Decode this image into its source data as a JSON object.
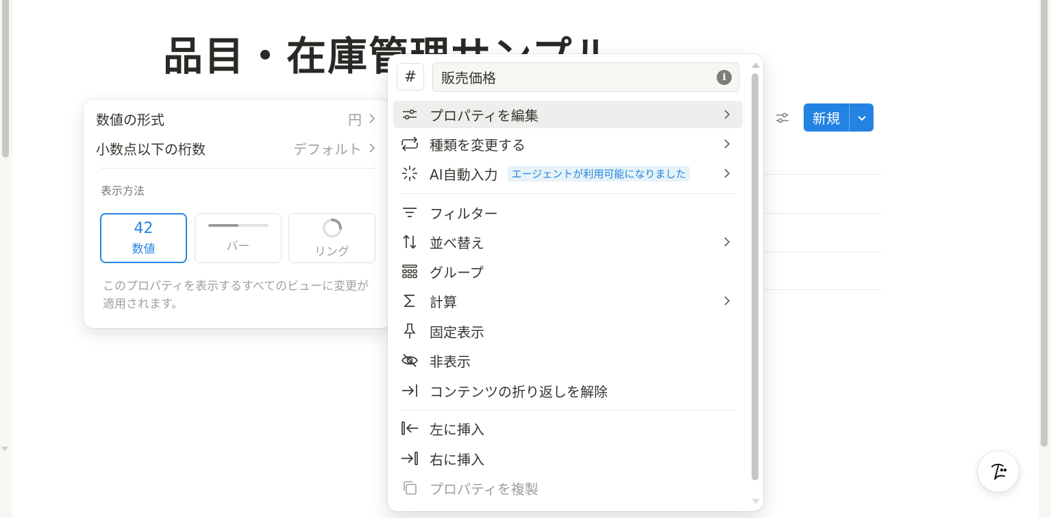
{
  "page": {
    "title": "品目・在庫管理サンプル"
  },
  "toolbar": {
    "settings_icon": "sliders-icon",
    "new_label": "新規",
    "new_dropdown_icon": "chevron-down-icon"
  },
  "format_panel": {
    "rows": [
      {
        "label": "数値の形式",
        "value": "円"
      },
      {
        "label": "小数点以下の桁数",
        "value": "デフォルト"
      }
    ],
    "section_label": "表示方法",
    "display_options": [
      {
        "big": "42",
        "label": "数値",
        "selected": true
      },
      {
        "label": "バー",
        "selected": false,
        "bar_fill_fraction": 0.5
      },
      {
        "label": "リング",
        "selected": false,
        "ring_fill_fraction": 0.25
      }
    ],
    "note": "このプロパティを表示するすべてのビューに変更が適用されます。"
  },
  "property_menu": {
    "type_icon": "#",
    "name_value": "販売価格",
    "info_icon_glyph": "i",
    "items": [
      {
        "label": "プロパティを編集",
        "icon": "sliders-icon",
        "chevron": true,
        "hover": true
      },
      {
        "label": "種類を変更する",
        "icon": "swap-icon",
        "chevron": true
      },
      {
        "label": "AI自動入力",
        "icon": "sparkle-icon",
        "badge": "エージェントが利用可能になりました",
        "chevron": true
      },
      {
        "label": "フィルター",
        "icon": "filter-icon",
        "chevron": false
      },
      {
        "label": "並べ替え",
        "icon": "sort-icon",
        "chevron": true
      },
      {
        "label": "グループ",
        "icon": "group-icon",
        "chevron": false
      },
      {
        "label": "計算",
        "icon": "sigma-icon",
        "chevron": true
      },
      {
        "label": "固定表示",
        "icon": "pin-icon",
        "chevron": false
      },
      {
        "label": "非表示",
        "icon": "eye-off-icon",
        "chevron": false
      },
      {
        "label": "コンテンツの折り返しを解除",
        "icon": "unwrap-icon",
        "chevron": false
      },
      {
        "label": "左に挿入",
        "icon": "insert-left-icon",
        "chevron": false
      },
      {
        "label": "右に挿入",
        "icon": "insert-right-icon",
        "chevron": false
      },
      {
        "label": "プロパティを複製",
        "icon": "duplicate-icon",
        "chevron": false,
        "disabled": true
      }
    ]
  },
  "colors": {
    "accent": "#2383e2",
    "text": "#37352f",
    "muted": "#a19f9a",
    "hover": "#efeeec",
    "badge_bg": "#e7f3f8"
  }
}
